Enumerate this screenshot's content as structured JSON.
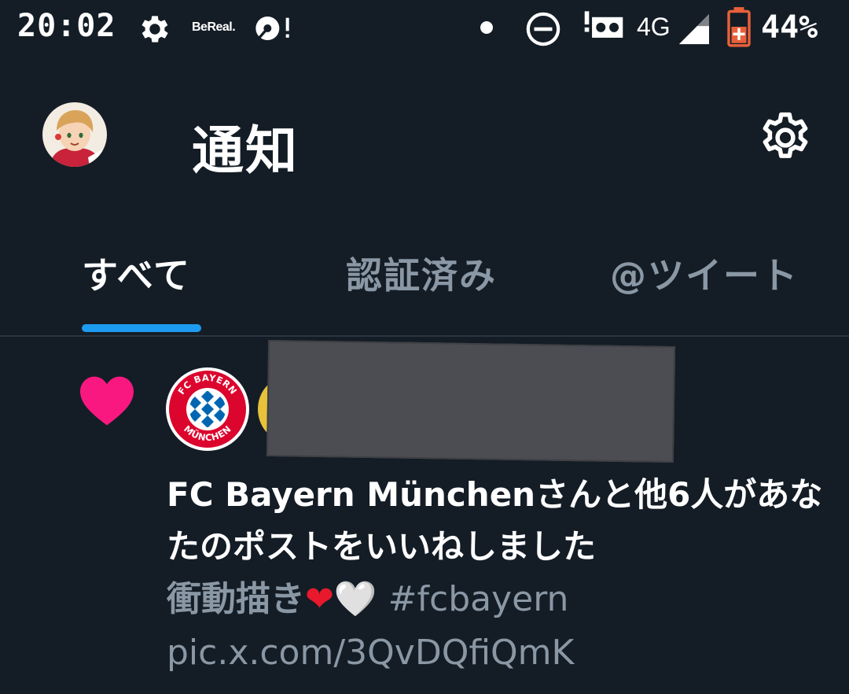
{
  "status_bar": {
    "time": "20:02",
    "bereal_label": "BeReal.",
    "network": "4G",
    "battery_pct": "44%",
    "icons": [
      "gear-icon",
      "bereal-icon",
      "disc-alert-icon",
      "dot-icon",
      "do-not-disturb-icon",
      "voicemail-icon",
      "signal-icon",
      "battery-icon"
    ]
  },
  "header": {
    "title": "通知"
  },
  "tabs": [
    {
      "label": "すべて",
      "active": true
    },
    {
      "label": "認証済み",
      "active": false
    },
    {
      "label": "@ツイート",
      "active": false
    }
  ],
  "colors": {
    "background": "#141d26",
    "accent": "#1d9bf0",
    "like": "#f91880",
    "muted_text": "#8a97a4"
  },
  "notification": {
    "type_icon": "heart-icon",
    "message": "FC Bayern Münchenさんと他6人があなたのポストをいいねしました",
    "preview_text": "衝動描き",
    "preview_emoji_1": "❤",
    "preview_emoji_2": "🤍",
    "preview_hashtag": "#fcbayern",
    "preview_link": "pic.x.com/3QvDQfiQmK",
    "bayern_badge_top": "FC BAYERN",
    "bayern_badge_bottom": "MÜNCHEN"
  }
}
